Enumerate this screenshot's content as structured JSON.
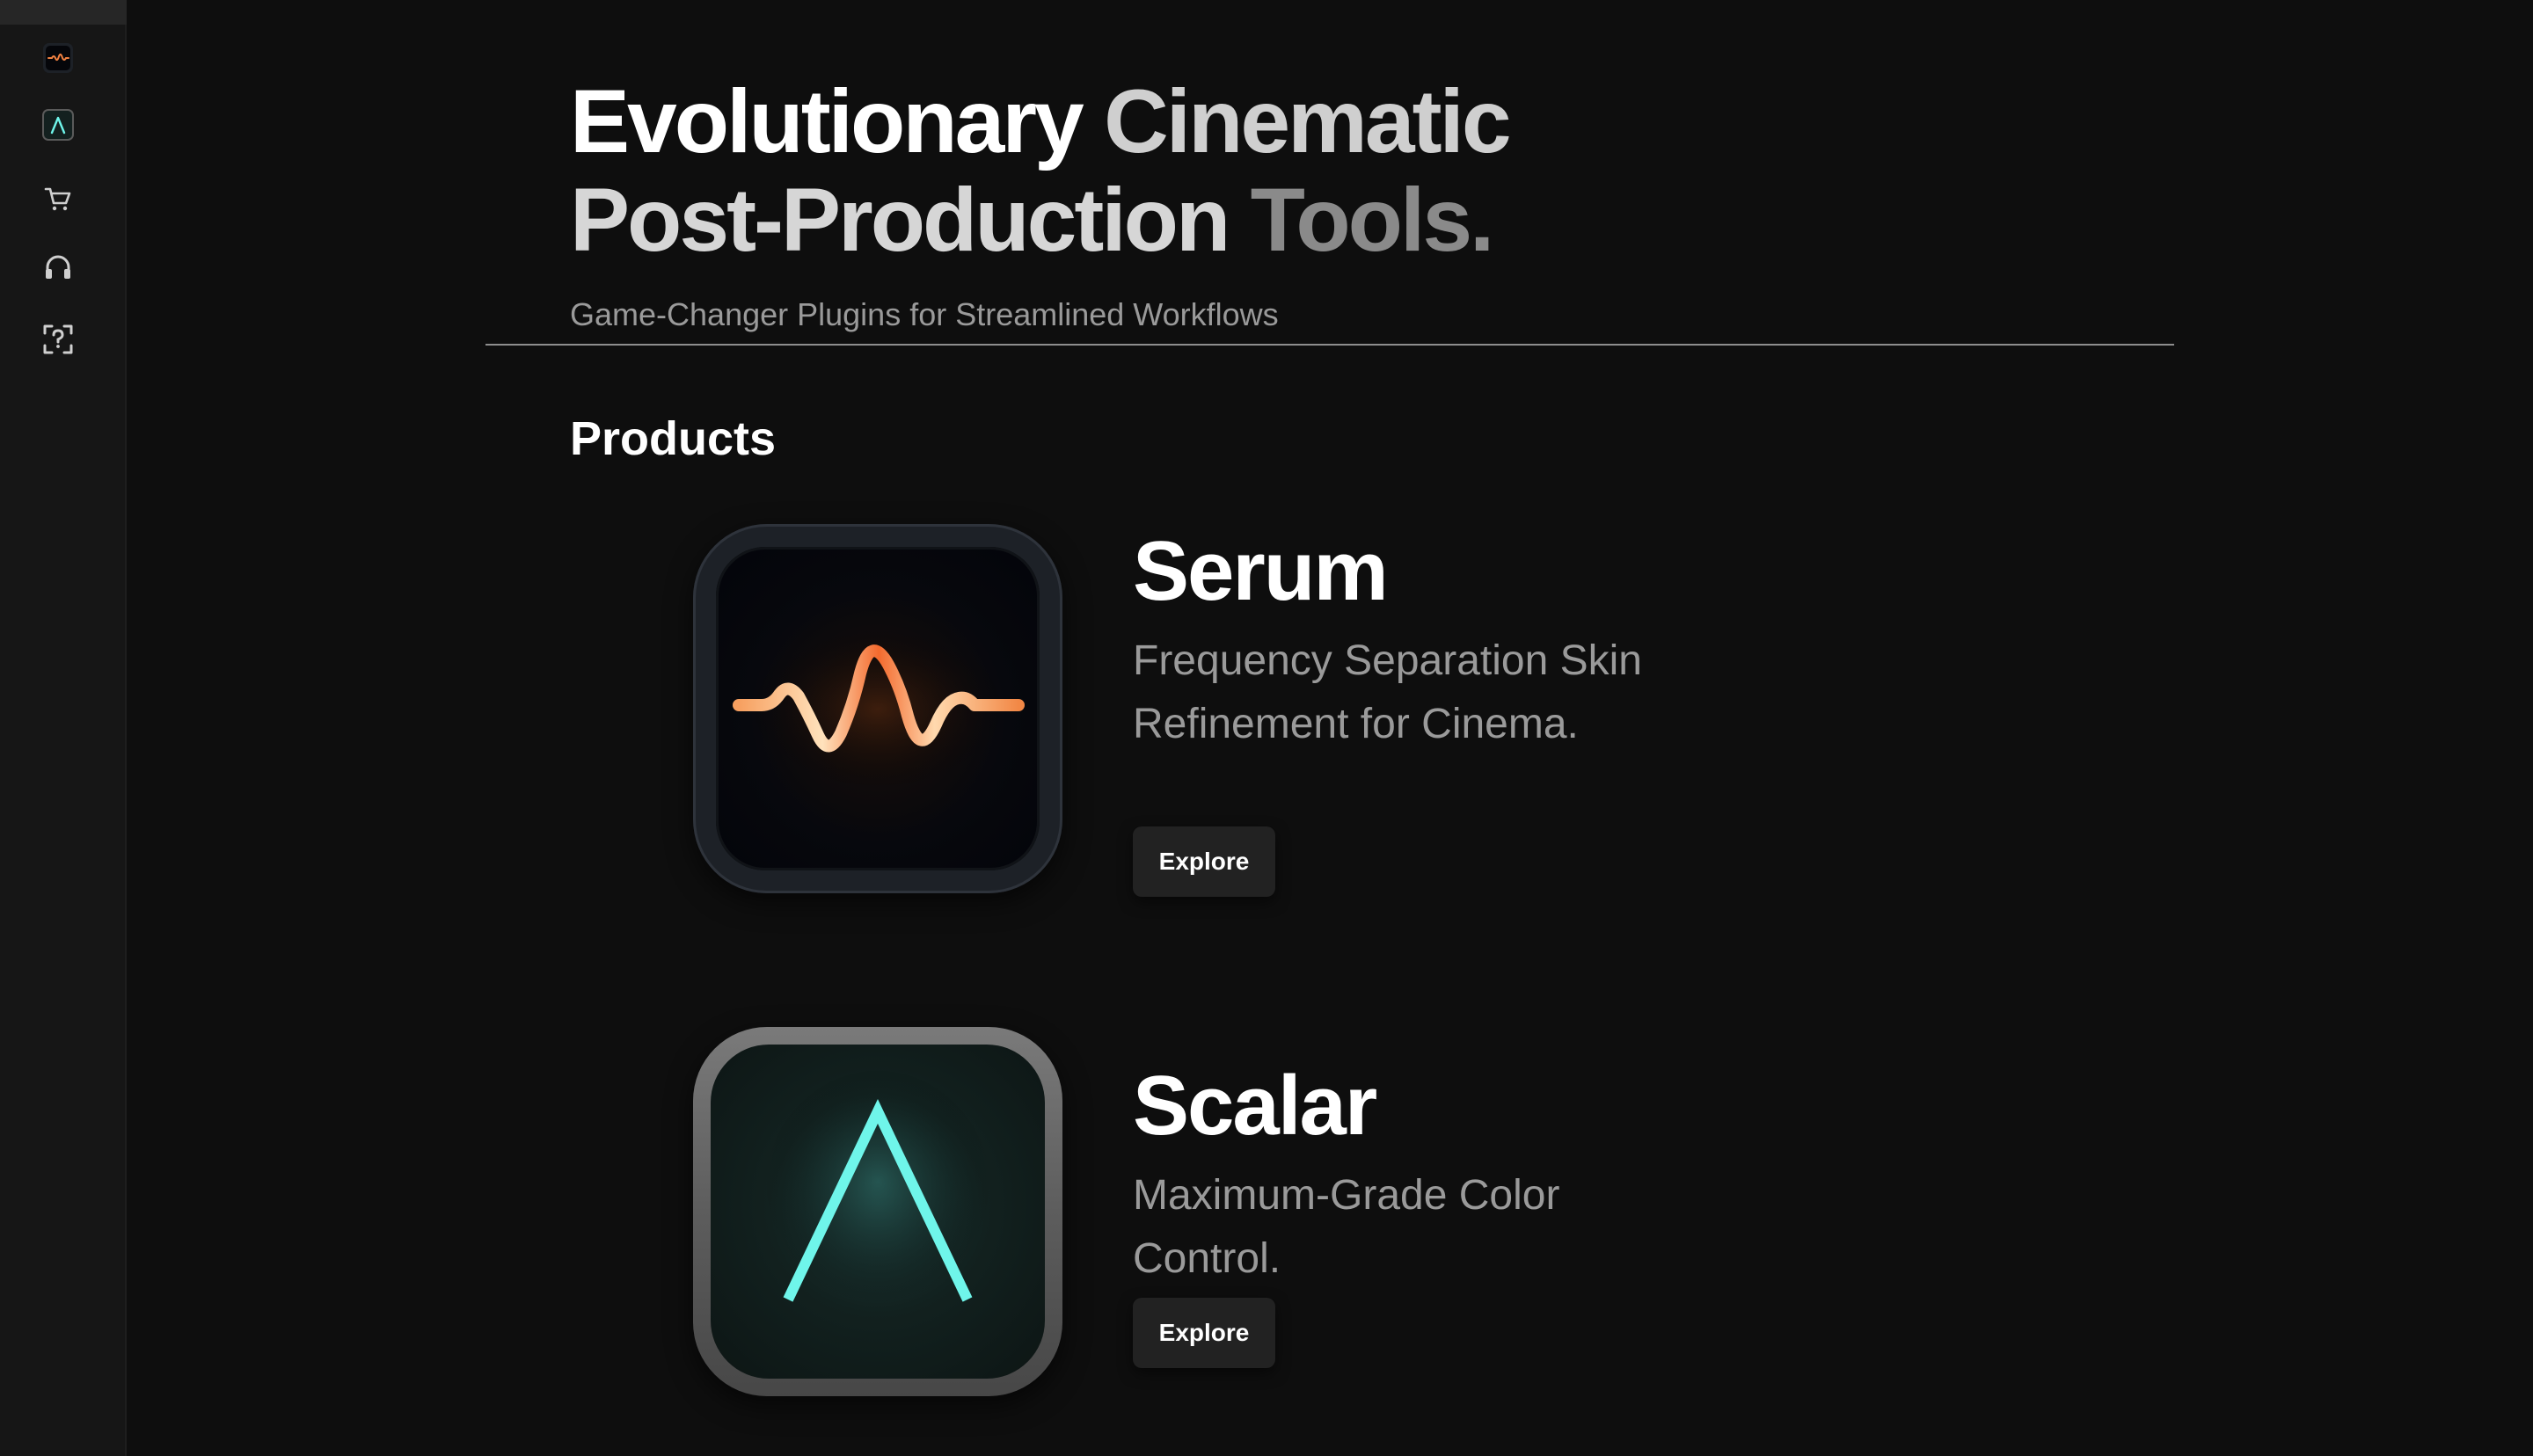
{
  "hero": {
    "title_part1": "Evolutionary",
    "title_part2": "Cinematic",
    "title_part3": "Post-Production",
    "title_part4": "Tools.",
    "subtitle": "Game-Changer Plugins for Streamlined Workflows"
  },
  "section": {
    "title": "Products"
  },
  "products": [
    {
      "name": "Serum",
      "description": "Frequency Separation Skin Refinement for Cinema.",
      "button_label": "Explore",
      "icon": "waveform-icon"
    },
    {
      "name": "Scalar",
      "description": "Maximum-Grade Color Control.",
      "button_label": "Explore",
      "icon": "lambda-icon"
    }
  ],
  "sidebar": {
    "items": [
      {
        "icon": "serum-app-icon"
      },
      {
        "icon": "scalar-app-icon"
      },
      {
        "icon": "cart-icon"
      },
      {
        "icon": "headphones-icon"
      },
      {
        "icon": "help-scan-icon"
      }
    ]
  },
  "colors": {
    "background": "#0e0e0e",
    "sidebar": "#161616",
    "serum_accent": "#f07a3a",
    "scalar_accent": "#6ff5ea",
    "muted_text": "#9a9a9a"
  }
}
